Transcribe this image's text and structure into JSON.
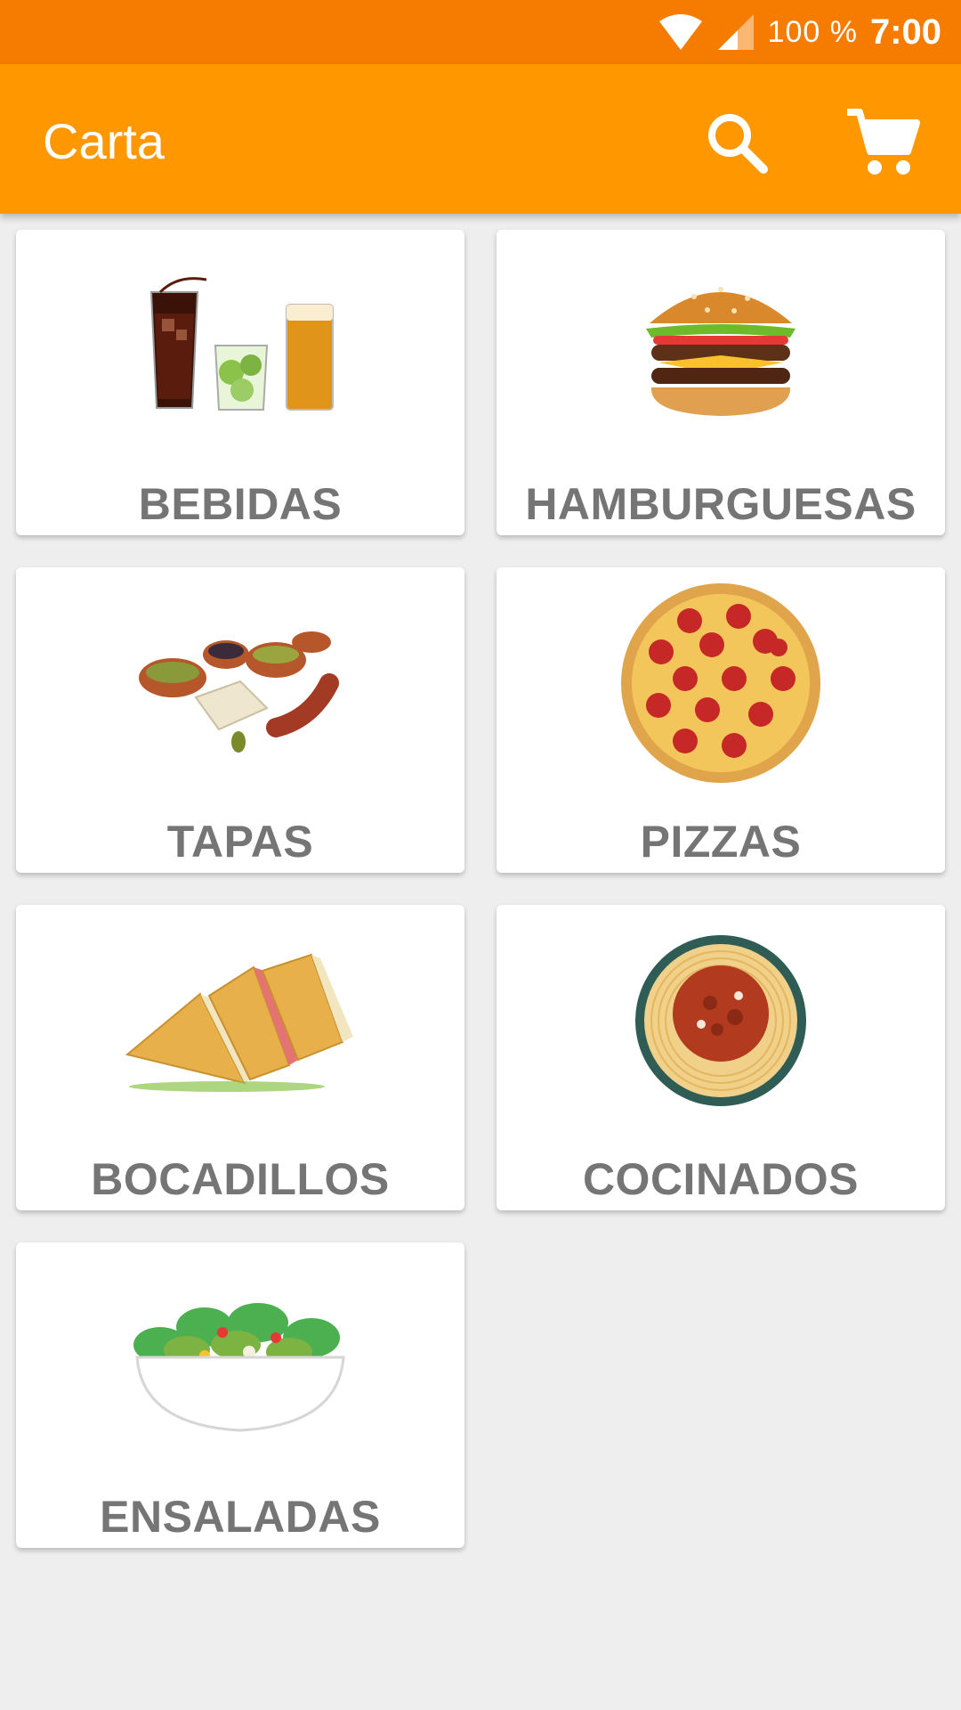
{
  "status_bar": {
    "battery": "100 %",
    "time": "7:00"
  },
  "app_bar": {
    "title": "Carta"
  },
  "categories": [
    {
      "label": "BEBIDAS",
      "icon": "drinks-image"
    },
    {
      "label": "HAMBURGUESAS",
      "icon": "burger-image"
    },
    {
      "label": "TAPAS",
      "icon": "tapas-image"
    },
    {
      "label": "PIZZAS",
      "icon": "pizza-image"
    },
    {
      "label": "BOCADILLOS",
      "icon": "sandwich-image"
    },
    {
      "label": "COCINADOS",
      "icon": "spaghetti-image"
    },
    {
      "label": "ENSALADAS",
      "icon": "salad-image"
    }
  ],
  "colors": {
    "status_bar": "#f57c00",
    "app_bar": "#ff9800",
    "background": "#eeeeee",
    "card_label": "#757575"
  }
}
